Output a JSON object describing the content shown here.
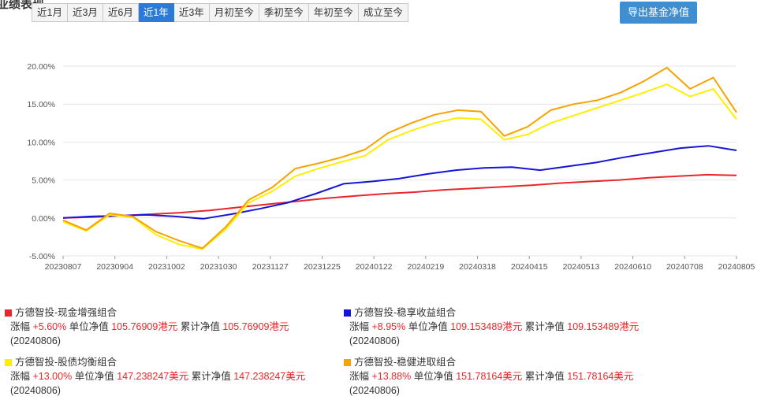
{
  "header": {
    "title": "业绩表现",
    "subtitle": "",
    "export_label": "导出基金净值"
  },
  "tabs": [
    {
      "label": "近1月",
      "active": false
    },
    {
      "label": "近3月",
      "active": false
    },
    {
      "label": "近6月",
      "active": false
    },
    {
      "label": "近1年",
      "active": true
    },
    {
      "label": "近3年",
      "active": false
    },
    {
      "label": "月初至今",
      "active": false
    },
    {
      "label": "季初至今",
      "active": false
    },
    {
      "label": "年初至今",
      "active": false
    },
    {
      "label": "成立至今",
      "active": false
    }
  ],
  "chart_data": {
    "type": "line",
    "y_ticks": [
      "20.00%",
      "15.00%",
      "10.00%",
      "5.00%",
      "0.00%",
      "-5.00%"
    ],
    "ylim": [
      -5,
      20
    ],
    "x_ticks": [
      "20230807",
      "20230904",
      "20231002",
      "20231030",
      "20231127",
      "20231225",
      "20240122",
      "20240219",
      "20240318",
      "20240415",
      "20240513",
      "20240610",
      "20240708",
      "20240805"
    ],
    "grid": "horizontal",
    "series": [
      {
        "name": "方德智投-现金增强组合",
        "color": "#e8262c",
        "values": [
          0.0,
          0.1,
          0.3,
          0.5,
          0.7,
          1.0,
          1.4,
          1.8,
          2.2,
          2.6,
          2.9,
          3.2,
          3.4,
          3.7,
          3.9,
          4.1,
          4.3,
          4.6,
          4.8,
          5.0,
          5.3,
          5.5,
          5.7,
          5.6
        ]
      },
      {
        "name": "方德智投-稳享收益组合",
        "color": "#1515d8",
        "values": [
          0.0,
          0.2,
          0.3,
          0.4,
          0.2,
          -0.1,
          0.5,
          1.2,
          2.0,
          3.2,
          4.5,
          4.8,
          5.2,
          5.8,
          6.3,
          6.6,
          6.7,
          6.3,
          6.8,
          7.3,
          8.0,
          8.6,
          9.2,
          9.5,
          8.9
        ]
      },
      {
        "name": "方德智投-股债均衡组合",
        "color": "#ffee00",
        "values": [
          -0.5,
          -1.7,
          0.4,
          0.1,
          -2.2,
          -3.5,
          -4.1,
          -1.5,
          2.0,
          3.5,
          5.5,
          6.5,
          7.4,
          8.2,
          10.3,
          11.5,
          12.5,
          13.2,
          13.0,
          10.3,
          11.0,
          12.5,
          13.5,
          14.5,
          15.5,
          16.5,
          17.6,
          16.0,
          17.0,
          13.0
        ]
      },
      {
        "name": "方德智投-稳健进取组合",
        "color": "#f5a300",
        "values": [
          -0.3,
          -1.6,
          0.6,
          0.2,
          -1.8,
          -3.0,
          -4.0,
          -1.2,
          2.4,
          4.0,
          6.5,
          7.2,
          8.0,
          9.0,
          11.2,
          12.5,
          13.6,
          14.2,
          14.0,
          10.8,
          12.0,
          14.2,
          15.0,
          15.5,
          16.5,
          18.0,
          19.8,
          17.0,
          18.5,
          13.9
        ]
      }
    ]
  },
  "legend": [
    {
      "name": "方德智投-现金增强组合",
      "color": "#e8262c",
      "change_label": "涨幅",
      "change": "+5.60%",
      "nav_label": "单位净值",
      "nav": "105.76909港元",
      "acc_label": "累计净值",
      "acc": "105.76909港元",
      "date": "(20240806)"
    },
    {
      "name": "方德智投-稳享收益组合",
      "color": "#1515d8",
      "change_label": "涨幅",
      "change": "+8.95%",
      "nav_label": "单位净值",
      "nav": "109.153489港元",
      "acc_label": "累计净值",
      "acc": "109.153489港元",
      "date": "(20240806)"
    },
    {
      "name": "方德智投-股债均衡组合",
      "color": "#ffee00",
      "change_label": "涨幅",
      "change": "+13.00%",
      "nav_label": "单位净值",
      "nav": "147.238247美元",
      "acc_label": "累计净值",
      "acc": "147.238247美元",
      "date": "(20240806)"
    },
    {
      "name": "方德智投-稳健进取组合",
      "color": "#f5a300",
      "change_label": "涨幅",
      "change": "+13.88%",
      "nav_label": "单位净值",
      "nav": "151.78164美元",
      "acc_label": "累计净值",
      "acc": "151.78164美元",
      "date": "(20240806)"
    }
  ]
}
